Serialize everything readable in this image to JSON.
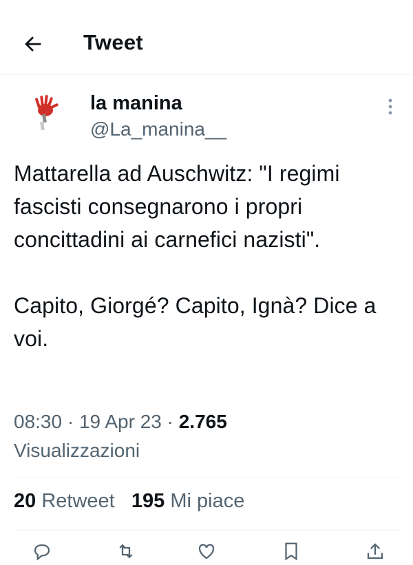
{
  "header": {
    "title": "Tweet"
  },
  "author": {
    "name": "la manina",
    "handle": "@La_manina__"
  },
  "tweet": {
    "text": "Mattarella ad Auschwitz: \"I regimi fascisti consegnarono i propri concittadini ai carnefici nazisti\".\n\nCapito, Giorgé? Capito, Ignà? Dice a voi."
  },
  "meta": {
    "time": "08:30",
    "date": "19 Apr 23",
    "separator": " · ",
    "views": "2.765",
    "views_label": "Visualizzazioni"
  },
  "stats": {
    "retweets": "20",
    "retweets_label": "Retweet",
    "likes": "195",
    "likes_label": "Mi piace"
  },
  "icons": {
    "back": "arrow-left-icon",
    "avatar": "red-hand-icon",
    "more": "more-vertical-icon",
    "actions": [
      "reply-icon",
      "retweet-icon",
      "like-icon",
      "bookmark-icon",
      "share-icon"
    ]
  },
  "colors": {
    "text": "#0f1419",
    "secondary": "#536471",
    "divider": "#eff3f4",
    "avatar": "#d0302a"
  }
}
